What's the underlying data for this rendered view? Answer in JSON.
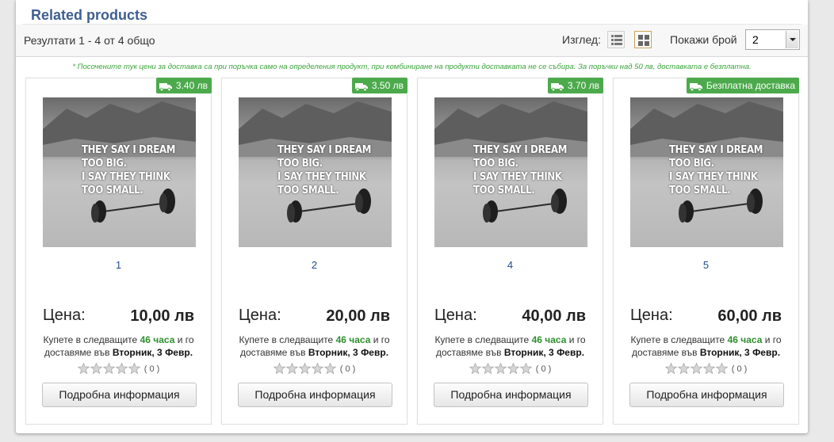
{
  "section": {
    "title": "Related products"
  },
  "toolbar": {
    "results_text": "Резултати 1 - 4 от 4 общо",
    "view_label": "Изглед:",
    "list_view_icon": "list-view-icon",
    "grid_view_icon": "grid-view-icon",
    "show_label": "Покажи брой",
    "per_page_value": "2"
  },
  "note": "* Посочените тук цени за доставка са при поръчка само на определения продукт, при комбиниране на продукти доставката не се събира. За поръчки над 50 лв, доставката е безплатна.",
  "quote_lines": [
    "THEY SAY I DREAM",
    "TOO BIG.",
    "I SAY THEY THINK",
    "TOO SMALL."
  ],
  "colors": {
    "accent_green": "#4caa4c",
    "link_blue": "#1f4f8d",
    "title_blue": "#3f5e93",
    "active_view_border": "#c9a25b"
  },
  "products": [
    {
      "badge": "3.40 лв",
      "name": "1",
      "price_label": "Цена:",
      "price": "10,00 лв",
      "delivery_pre": "Купете в следващите",
      "hours": "46 часа",
      "delivery_mid": "и го доставяме във",
      "day": "Вторник, 3 Февр.",
      "rating": "( 0 )",
      "button": "Подробна информация"
    },
    {
      "badge": "3.50 лв",
      "name": "2",
      "price_label": "Цена:",
      "price": "20,00 лв",
      "delivery_pre": "Купете в следващите",
      "hours": "46 часа",
      "delivery_mid": "и го доставяме във",
      "day": "Вторник, 3 Февр.",
      "rating": "( 0 )",
      "button": "Подробна информация"
    },
    {
      "badge": "3.70 лв",
      "name": "4",
      "price_label": "Цена:",
      "price": "40,00 лв",
      "delivery_pre": "Купете в следващите",
      "hours": "46 часа",
      "delivery_mid": "и го доставяме във",
      "day": "Вторник, 3 Февр.",
      "rating": "( 0 )",
      "button": "Подробна информация"
    },
    {
      "badge": "Безплатна доставка",
      "name": "5",
      "price_label": "Цена:",
      "price": "60,00 лв",
      "delivery_pre": "Купете в следващите",
      "hours": "46 часа",
      "delivery_mid": "и го доставяме във",
      "day": "Вторник, 3 Февр.",
      "rating": "( 0 )",
      "button": "Подробна информация"
    }
  ]
}
